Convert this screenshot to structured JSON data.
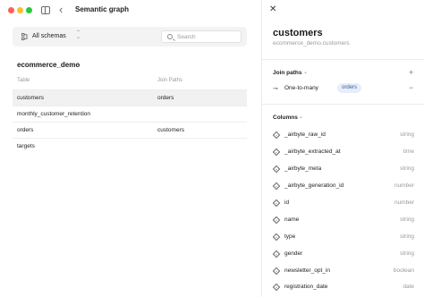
{
  "window": {
    "title": "Semantic graph"
  },
  "filter": {
    "schema_label": "All schemas",
    "search_placeholder": "Search"
  },
  "database": {
    "name": "ecommerce_demo"
  },
  "table": {
    "headers": [
      "Table",
      "Join Paths"
    ],
    "rows": [
      {
        "table": "customers",
        "join": "orders",
        "selected": true
      },
      {
        "table": "monthly_customer_retention",
        "join": "",
        "selected": false
      },
      {
        "table": "orders",
        "join": "customers",
        "selected": false
      },
      {
        "table": "targets",
        "join": "",
        "selected": false
      }
    ]
  },
  "panel": {
    "title": "customers",
    "subtitle": "ecommerce_demo.customers",
    "join_paths": {
      "title": "Join paths",
      "items": [
        {
          "relation": "One-to-many",
          "target": "orders"
        }
      ]
    },
    "columns": {
      "title": "Columns",
      "items": [
        {
          "name": "_airbyte_raw_id",
          "type": "string"
        },
        {
          "name": "_airbyte_extracted_at",
          "type": "time"
        },
        {
          "name": "_airbyte_meta",
          "type": "string"
        },
        {
          "name": "_airbyte_generation_id",
          "type": "number"
        },
        {
          "name": "id",
          "type": "number"
        },
        {
          "name": "name",
          "type": "string"
        },
        {
          "name": "type",
          "type": "string"
        },
        {
          "name": "gender",
          "type": "string"
        },
        {
          "name": "newsletter_opt_in",
          "type": "boolean"
        },
        {
          "name": "registration_date",
          "type": "date"
        }
      ]
    }
  },
  "icons": {
    "close": "close-icon",
    "back": "chevron-left-icon",
    "sidebar": "sidebar-toggle-icon",
    "search": "search-icon",
    "add": "plus-icon",
    "remove": "minus-icon",
    "column": "column-diamond-icon"
  },
  "colors": {
    "selected_row": "#f1f1f1",
    "pill_bg": "#e8eef9",
    "pill_text": "#3b5ca8"
  }
}
